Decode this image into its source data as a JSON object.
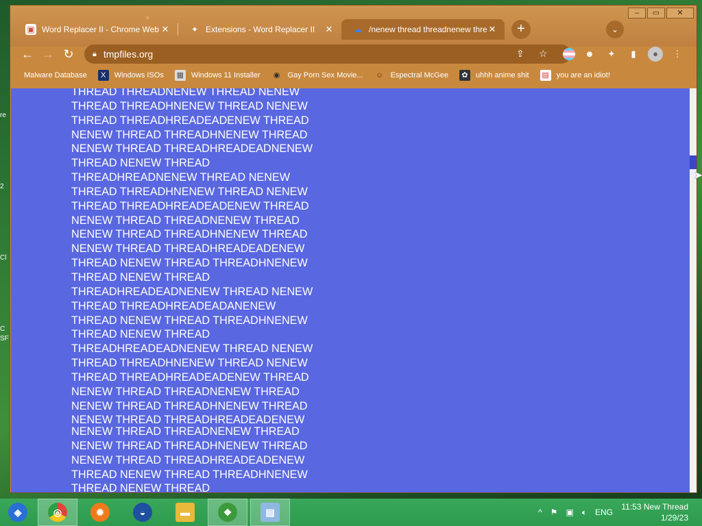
{
  "desktop": {
    "edge_labels": [
      "re",
      "2",
      "Cl",
      "C",
      "SF"
    ]
  },
  "window": {
    "controls": {
      "minimize": "–",
      "maximize": "▭",
      "close": "✕"
    }
  },
  "tabs": [
    {
      "label": "Word Replacer II - Chrome Web",
      "icon": "chrome-web-store-icon",
      "glyph": "▣",
      "icon_color": "#d34a3a",
      "active": false
    },
    {
      "label": "Extensions - Word Replacer II",
      "icon": "puzzle-icon",
      "glyph": "✦",
      "icon_color": "#ffffff",
      "active": false
    },
    {
      "label": "/nenew thread threadnenew thre",
      "icon": "cloud-icon",
      "glyph": "☁",
      "icon_color": "#3b82f6",
      "active": true
    }
  ],
  "toolbar": {
    "url": "tmpfiles.org"
  },
  "bookmarks": [
    {
      "label": "Malware Database",
      "icon": "blank-bookmark-icon",
      "glyph": "",
      "icon_color": "transparent"
    },
    {
      "label": "Windows ISOs",
      "icon": "x-logo-icon",
      "glyph": "X",
      "icon_color": "#1a2f6b"
    },
    {
      "label": "Windows 11 Installer",
      "icon": "installer-icon",
      "glyph": "▦",
      "icon_color": "#8a8a8a"
    },
    {
      "label": "Gay Porn Sex Movie...",
      "icon": "site-icon",
      "glyph": "◉",
      "icon_color": "#2b2b2b"
    },
    {
      "label": "Espectral McGee",
      "icon": "character-icon",
      "glyph": "☺",
      "icon_color": "#b54a2a"
    },
    {
      "label": "uhhh anime shit",
      "icon": "anime-icon",
      "glyph": "✿",
      "icon_color": "#333333"
    },
    {
      "label": "you are an idiot!",
      "icon": "flag-bookmark-icon",
      "glyph": "▤",
      "icon_color": "#c33"
    }
  ],
  "page": {
    "background": "#5967e0",
    "lines_top": [
      "THREAD THREADNENEW THREAD NENEW",
      "THREAD THREADHNENEW THREAD NENEW",
      "THREAD THREADHREADEADENEW THREAD",
      "NENEW THREAD THREADHNENEW THREAD",
      "NENEW THREAD THREADHREADEADNENEW",
      "THREAD NENEW THREAD",
      "THREADHREADNENEW THREAD NENEW",
      "THREAD THREADHNENEW THREAD NENEW",
      "THREAD THREADHREADEADENEW THREAD",
      "NENEW THREAD THREADNENEW THREAD",
      "NENEW THREAD THREADHNENEW THREAD",
      "NENEW THREAD THREADHREADEADENEW",
      "THREAD NENEW THREAD THREADHNENEW",
      "THREAD NENEW THREAD",
      "THREADHREADEADNENEW THREAD NENEW",
      "THREAD THREADHREADEADANENEW",
      "THREAD NENEW THREAD THREADHNENEW",
      "THREAD NENEW THREAD",
      "THREADHREADEADNENEW THREAD NENEW",
      "THREAD THREADHNENEW THREAD NENEW",
      "THREAD THREADHREADEADENEW THREAD",
      "NENEW THREAD THREADNENEW THREAD",
      "NENEW THREAD THREADHNENEW THREAD",
      "NENEW THREAD THREADHREADEADENEW"
    ],
    "lines_bottom": [
      "NENEW THREAD THREADNENEW THREAD",
      "NENEW THREAD THREADHNENEW THREAD",
      "NENEW THREAD THREADHREADEADENEW",
      "THREAD NENEW THREAD THREADHNENEW",
      "THREAD NENEW THREAD"
    ]
  },
  "taskbar": {
    "apps": [
      {
        "name": "start-button",
        "icon": "windows-logo-icon",
        "glyph": "◈",
        "color": "#2a6fd6",
        "active": false
      },
      {
        "name": "chrome-taskbar-button",
        "icon": "chrome-icon",
        "glyph": "◎",
        "color": "#e0453a",
        "active": true
      },
      {
        "name": "firefox-taskbar-button",
        "icon": "firefox-icon",
        "glyph": "✹",
        "color": "#f07a1a",
        "active": false
      },
      {
        "name": "obama-taskbar-button",
        "icon": "obama-logo-icon",
        "glyph": "◒",
        "color": "#1f4fa0",
        "active": false
      },
      {
        "name": "file-explorer-taskbar-button",
        "icon": "folder-icon",
        "glyph": "▬",
        "color": "#e8b93a",
        "active": false
      },
      {
        "name": "app-taskbar-button",
        "icon": "green-app-icon",
        "glyph": "❖",
        "color": "#3c9a3c",
        "active": true
      },
      {
        "name": "notepad-taskbar-button",
        "icon": "notepad-icon",
        "glyph": "▤",
        "color": "#8fb8e0",
        "active": true
      }
    ],
    "tray": {
      "chevron": "^",
      "language": "ENG",
      "time": "11:53 New Thread",
      "date": "1/29/23"
    }
  }
}
